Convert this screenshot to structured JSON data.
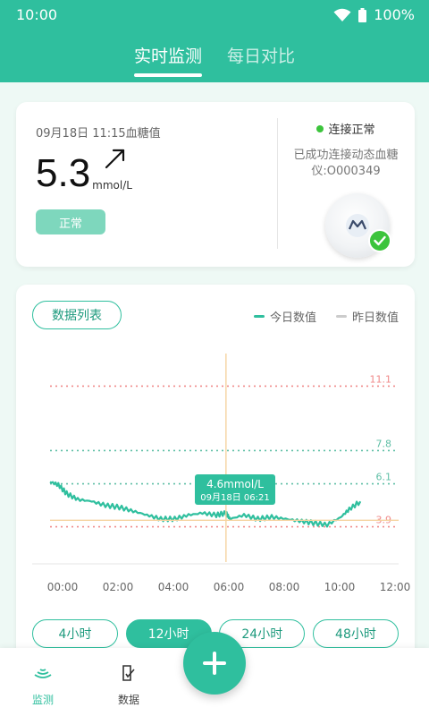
{
  "status_bar": {
    "time": "10:00",
    "battery": "100%"
  },
  "tabs": [
    {
      "label": "实时监测",
      "active": true
    },
    {
      "label": "每日对比",
      "active": false
    }
  ],
  "reading": {
    "time_label": "09月18日 11:15血糖值",
    "value": "5.3",
    "unit": "mmol/L",
    "trend_icon": "arrow-up-right-icon",
    "status_badge": "正常"
  },
  "device": {
    "status": "连接正常",
    "description": "已成功连接动态血糖仪:O000349",
    "status_color": "#3cc43c"
  },
  "chart_panel": {
    "list_button": "数据列表",
    "legend": [
      {
        "label": "今日数值",
        "color": "#2fbf9e"
      },
      {
        "label": "昨日数值",
        "color": "#cccccc"
      }
    ],
    "tooltip": {
      "value": "4.6mmol/L",
      "time": "09月18日 06:21"
    },
    "range_buttons": [
      {
        "label": "4小时",
        "active": false
      },
      {
        "label": "12小时",
        "active": true
      },
      {
        "label": "24小时",
        "active": false
      },
      {
        "label": "48小时",
        "active": false
      }
    ]
  },
  "chart_data": {
    "type": "line",
    "x_ticks": [
      "00:00",
      "02:00",
      "04:00",
      "06:00",
      "08:00",
      "10:00",
      "12:00"
    ],
    "reference_lines": [
      {
        "value": 11.1,
        "label": "11.1",
        "color": "#f08a8a"
      },
      {
        "value": 7.8,
        "label": "7.8",
        "color": "#5fbfa6"
      },
      {
        "value": 6.1,
        "label": "6.1",
        "color": "#5fbfa6"
      },
      {
        "value": 3.9,
        "label": "3.9",
        "color": "#f08a8a"
      }
    ],
    "series": [
      {
        "name": "今日数值",
        "x_hours": [
          0,
          0.3,
          0.6,
          1.0,
          1.5,
          2.0,
          2.5,
          3.0,
          3.5,
          4.0,
          4.5,
          5.0,
          5.5,
          6.0,
          6.35,
          6.5,
          7.0,
          7.5,
          8.0,
          8.5,
          9.0,
          9.5,
          10.0,
          10.5,
          10.8,
          11.2
        ],
        "values": [
          6.2,
          6.05,
          5.6,
          5.3,
          5.2,
          5.0,
          4.9,
          4.7,
          4.5,
          4.3,
          4.3,
          4.5,
          4.6,
          4.5,
          4.6,
          4.3,
          4.5,
          4.3,
          4.4,
          4.3,
          4.2,
          4.1,
          4.0,
          4.4,
          4.8,
          5.2
        ]
      }
    ],
    "crosshair": {
      "x_hour": 6.35,
      "value": 4.6
    },
    "ylim": [
      2.0,
      13.0
    ],
    "xlim": [
      0,
      12
    ]
  }
}
